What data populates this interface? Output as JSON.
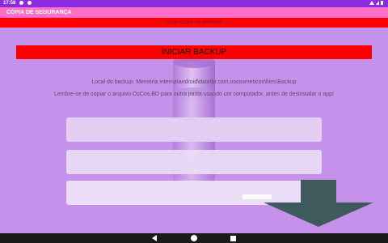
{
  "status_bar": {
    "time": "17:58"
  },
  "app_bar": {
    "title": "CÓPIA DE SEGURANÇA"
  },
  "sub_bar": {
    "text": "Criar cópia no telefone"
  },
  "backup": {
    "button_label": "INICIAR BACKUP"
  },
  "info": {
    "location": "Local do backup: Memória interna\\android\\data\\br.com.oscosmeticos\\files\\Backup",
    "reminder": "Lembre-se de copiar o arquivo OsCos.BD para outra pasta usando um computador, antes de desinstalar o app!"
  },
  "colors": {
    "background": "#c691ea",
    "status_bar": "#8a2be2",
    "app_bar": "#ff6ec7",
    "accent_red": "#ff0000",
    "arrow": "#3f5a5c"
  },
  "icons": {
    "graphic": "database-download-icon",
    "nav_back": "back-triangle-icon",
    "nav_home": "home-circle-icon",
    "nav_recents": "recents-square-icon"
  }
}
